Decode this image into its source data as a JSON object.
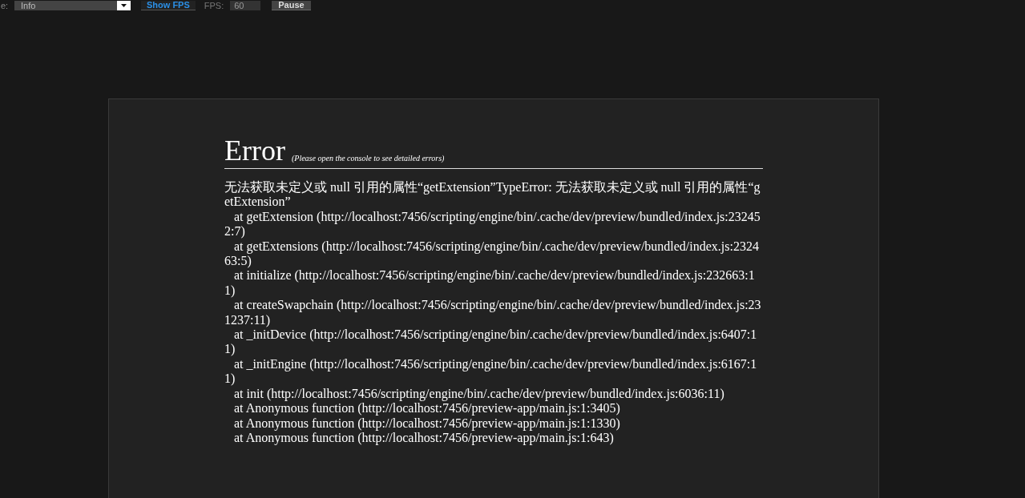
{
  "toolbar": {
    "level_label": "e:",
    "level_select": "Info",
    "show_fps_button": "Show FPS",
    "fps_label": "FPS:",
    "fps_field": "60",
    "pause_button": "Pause"
  },
  "error": {
    "title": "Error",
    "hint": "(Please open the console to see detailed errors)",
    "message": "无法获取未定义或 null 引用的属性“getExtension”TypeError: 无法获取未定义或 null 引用的属性“getExtension”",
    "stack": [
      "at getExtension (http://localhost:7456/scripting/engine/bin/.cache/dev/preview/bundled/index.js:232452:7)",
      "at getExtensions (http://localhost:7456/scripting/engine/bin/.cache/dev/preview/bundled/index.js:232463:5)",
      "at initialize (http://localhost:7456/scripting/engine/bin/.cache/dev/preview/bundled/index.js:232663:11)",
      "at createSwapchain (http://localhost:7456/scripting/engine/bin/.cache/dev/preview/bundled/index.js:231237:11)",
      "at _initDevice (http://localhost:7456/scripting/engine/bin/.cache/dev/preview/bundled/index.js:6407:11)",
      "at _initEngine (http://localhost:7456/scripting/engine/bin/.cache/dev/preview/bundled/index.js:6167:11)",
      "at init (http://localhost:7456/scripting/engine/bin/.cache/dev/preview/bundled/index.js:6036:11)",
      "at Anonymous function (http://localhost:7456/preview-app/main.js:1:3405)",
      "at Anonymous function (http://localhost:7456/preview-app/main.js:1:1330)",
      "at Anonymous function (http://localhost:7456/preview-app/main.js:1:643)"
    ]
  }
}
